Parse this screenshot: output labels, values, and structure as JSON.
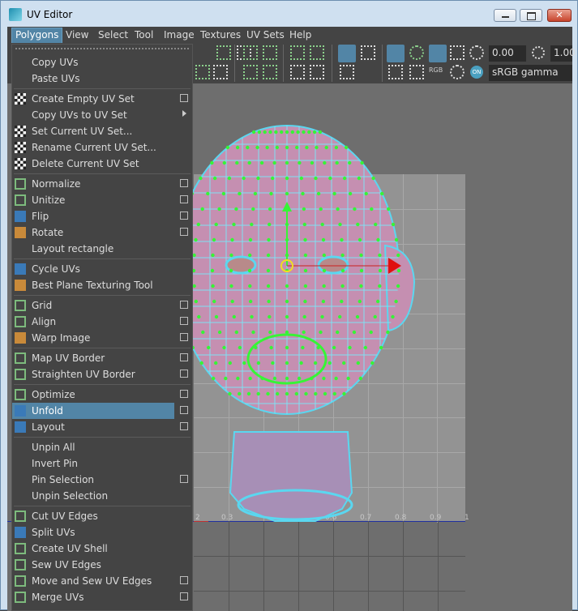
{
  "window": {
    "title": "UV Editor"
  },
  "menubar": [
    "Polygons",
    "View",
    "Select",
    "Tool",
    "Image",
    "Textures",
    "UV Sets",
    "Help"
  ],
  "toolbar": {
    "value1": "0.00",
    "value2": "1.00",
    "colorspace": "sRGB gamma",
    "rgb_label": "RGB",
    "on_label": "ON"
  },
  "axis_ticks": [
    "2",
    "0.3",
    "0.6",
    "0.7",
    "0.8",
    "0.9",
    "1"
  ],
  "menu": [
    {
      "label": "Copy UVs",
      "icon": "",
      "ob": false
    },
    {
      "label": "Paste UVs",
      "icon": "",
      "ob": false
    },
    {
      "sep": true
    },
    {
      "label": "Create Empty UV Set",
      "icon": "checker-icon",
      "ob": true
    },
    {
      "label": "Copy UVs to UV Set",
      "icon": "",
      "sub": true
    },
    {
      "label": "Set Current UV Set...",
      "icon": "checker-icon",
      "ob": false
    },
    {
      "label": "Rename Current UV Set...",
      "icon": "checker-icon",
      "ob": false
    },
    {
      "label": "Delete Current UV Set",
      "icon": "checker-icon",
      "ob": false
    },
    {
      "sep": true
    },
    {
      "label": "Normalize",
      "icon": "normalize-icon",
      "ob": true
    },
    {
      "label": "Unitize",
      "icon": "unitize-icon",
      "ob": true
    },
    {
      "label": "Flip",
      "icon": "flip-icon",
      "ob": true
    },
    {
      "label": "Rotate",
      "icon": "rotate-icon",
      "ob": true
    },
    {
      "label": "Layout rectangle",
      "icon": "",
      "ob": false
    },
    {
      "sep": true
    },
    {
      "label": "Cycle UVs",
      "icon": "cycle-icon",
      "ob": false
    },
    {
      "label": "Best Plane Texturing Tool",
      "icon": "best-plane-icon",
      "ob": false
    },
    {
      "sep": true
    },
    {
      "label": "Grid",
      "icon": "grid-icon",
      "ob": true
    },
    {
      "label": "Align",
      "icon": "align-icon",
      "ob": true
    },
    {
      "label": "Warp Image",
      "icon": "warp-icon",
      "ob": true
    },
    {
      "sep": true
    },
    {
      "label": "Map UV Border",
      "icon": "map-border-icon",
      "ob": true
    },
    {
      "label": "Straighten UV Border",
      "icon": "straighten-icon",
      "ob": true
    },
    {
      "sep": true
    },
    {
      "label": "Optimize",
      "icon": "optimize-icon",
      "ob": true
    },
    {
      "label": "Unfold",
      "icon": "unfold-icon",
      "ob": true,
      "hl": true
    },
    {
      "label": "Layout",
      "icon": "layout-icon",
      "ob": true
    },
    {
      "sep": true
    },
    {
      "label": "Unpin All",
      "icon": "",
      "ob": false
    },
    {
      "label": "Invert Pin",
      "icon": "",
      "ob": false
    },
    {
      "label": "Pin Selection",
      "icon": "",
      "ob": true
    },
    {
      "label": "Unpin Selection",
      "icon": "",
      "ob": false
    },
    {
      "sep": true
    },
    {
      "label": "Cut UV Edges",
      "icon": "cut-icon",
      "ob": false
    },
    {
      "label": "Split UVs",
      "icon": "split-icon",
      "ob": false
    },
    {
      "label": "Create UV Shell",
      "icon": "shell-icon",
      "ob": false
    },
    {
      "label": "Sew UV Edges",
      "icon": "sew-icon",
      "ob": false
    },
    {
      "label": "Move and Sew UV Edges",
      "icon": "move-sew-icon",
      "ob": true
    },
    {
      "label": "Merge UVs",
      "icon": "merge-icon",
      "ob": true
    }
  ]
}
